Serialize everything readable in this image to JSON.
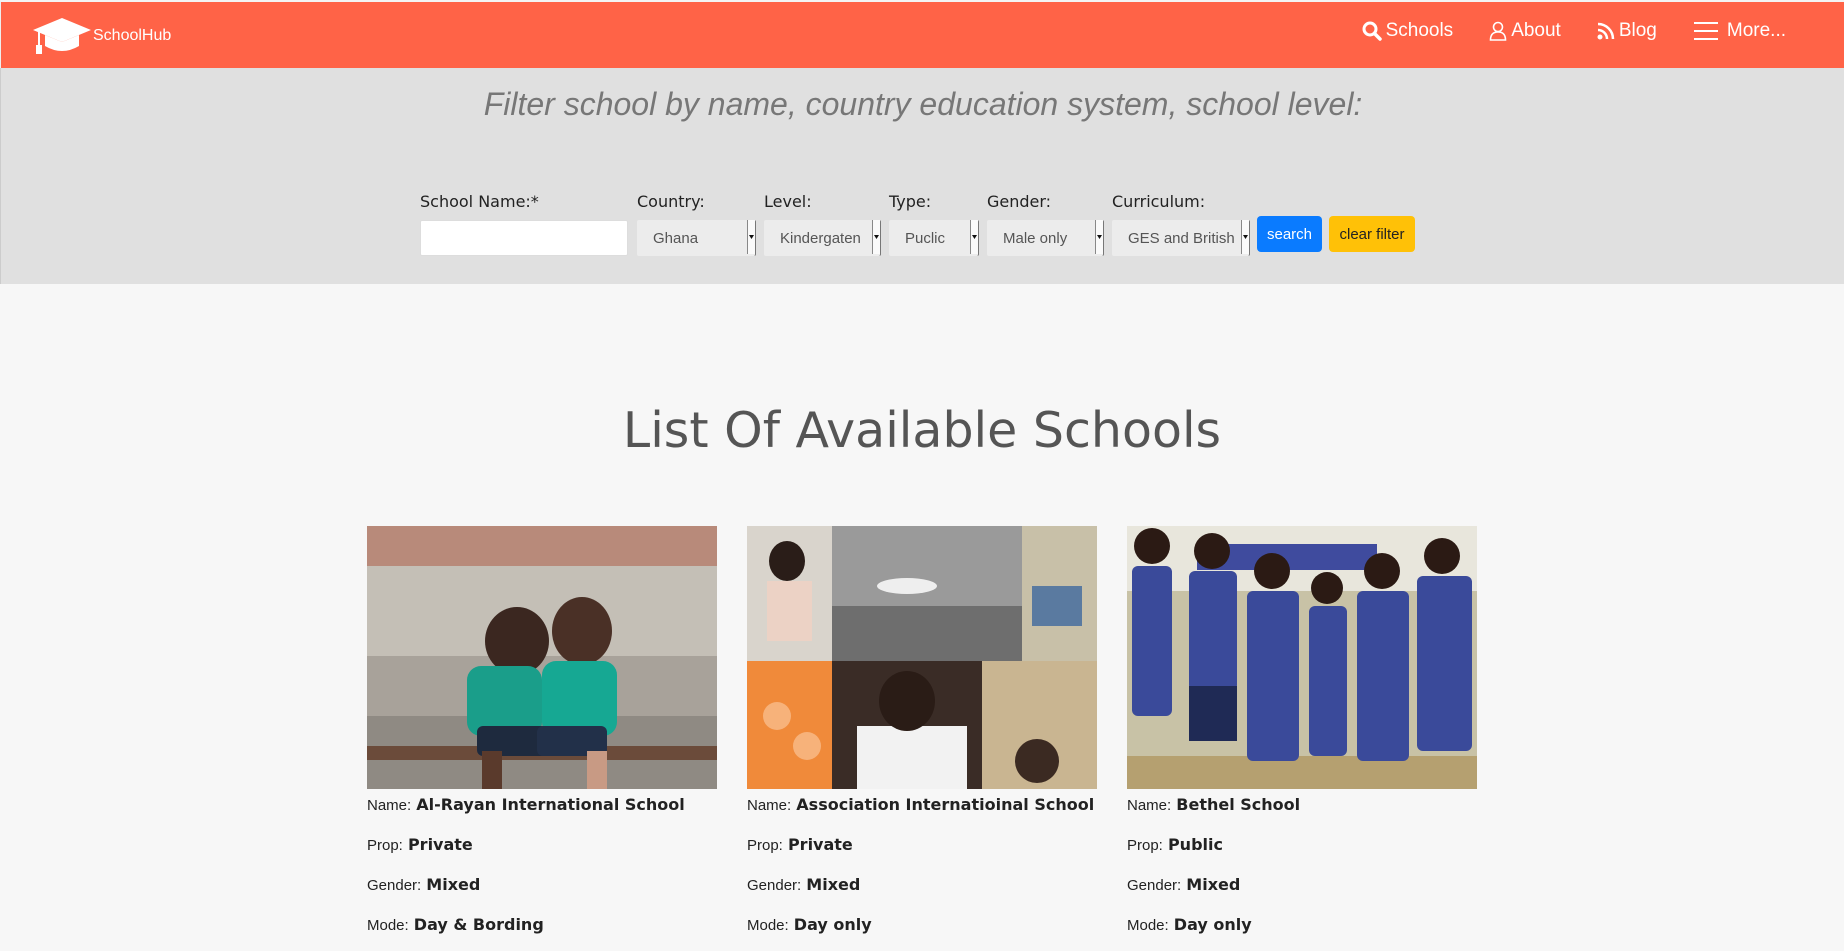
{
  "navbar": {
    "brand": "SchoolHub",
    "links": [
      {
        "label": "Schools",
        "icon": "search-icon"
      },
      {
        "label": "About",
        "icon": "user-icon"
      },
      {
        "label": "Blog",
        "icon": "rss-icon"
      },
      {
        "label": "More...",
        "icon": "menu-icon"
      }
    ],
    "color": "#ff6347"
  },
  "filter": {
    "heading": "Filter school by name, country education system, school level:",
    "fields": {
      "school_name": {
        "label": "School Name:*",
        "value": ""
      },
      "country": {
        "label": "Country:",
        "value": "Ghana"
      },
      "level": {
        "label": "Level:",
        "value": "Kindergaten"
      },
      "type": {
        "label": "Type:",
        "value": "Puclic"
      },
      "gender": {
        "label": "Gender:",
        "value": "Male only"
      },
      "curriculum": {
        "label": "Curriculum:",
        "value": "GES and British"
      }
    },
    "search_label": "search",
    "clear_label": "clear filter"
  },
  "main": {
    "title": "List Of Available Schools",
    "keys": {
      "name": "Name:",
      "prop": "Prop:",
      "gender": "Gender:",
      "mode": "Mode:"
    },
    "schools": [
      {
        "name": "Al-Rayan International School",
        "prop": "Private",
        "gender": "Mixed",
        "mode": "Day & Bording"
      },
      {
        "name": "Association Internatioinal School",
        "prop": "Private",
        "gender": "Mixed",
        "mode": "Day only"
      },
      {
        "name": "Bethel School",
        "prop": "Public",
        "gender": "Mixed",
        "mode": "Day only"
      }
    ]
  }
}
